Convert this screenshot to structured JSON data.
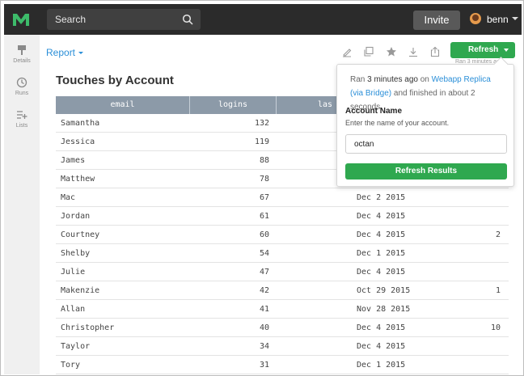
{
  "app": {
    "logo_icon": "mode-logo-icon",
    "search_label": "Search",
    "invite_label": "Invite",
    "user_name": "benn"
  },
  "sidebar": {
    "items": [
      {
        "label": "Details",
        "icon": "details-icon"
      },
      {
        "label": "Runs",
        "icon": "clock-icon"
      },
      {
        "label": "Lists",
        "icon": "list-add-icon"
      }
    ]
  },
  "report": {
    "dropdown_label": "Report",
    "title": "Touches by Account",
    "refresh_label": "Refresh",
    "ran_hint": "Ran 3 minutes ago",
    "toolbar_icons": [
      "edit-icon",
      "duplicate-icon",
      "star-icon",
      "download-icon",
      "share-icon"
    ]
  },
  "table": {
    "columns": [
      "email",
      "logins",
      "las"
    ],
    "rows": [
      {
        "name": "Samantha",
        "logins": "132",
        "date": "",
        "extra": ""
      },
      {
        "name": "Jessica",
        "logins": "119",
        "date": "",
        "extra": ""
      },
      {
        "name": "James",
        "logins": "88",
        "date": "",
        "extra": ""
      },
      {
        "name": "Matthew",
        "logins": "78",
        "date": "",
        "extra": ""
      },
      {
        "name": "Mac",
        "logins": "67",
        "date": "Dec 2 2015",
        "extra": ""
      },
      {
        "name": "Jordan",
        "logins": "61",
        "date": "Dec 4 2015",
        "extra": ""
      },
      {
        "name": "Courtney",
        "logins": "60",
        "date": "Dec 4 2015",
        "extra": "2"
      },
      {
        "name": "Shelby",
        "logins": "54",
        "date": "Dec 1 2015",
        "extra": ""
      },
      {
        "name": "Julie",
        "logins": "47",
        "date": "Dec 4 2015",
        "extra": ""
      },
      {
        "name": "Makenzie",
        "logins": "42",
        "date": "Oct 29 2015",
        "extra": "1"
      },
      {
        "name": "Allan",
        "logins": "41",
        "date": "Nov 28 2015",
        "extra": ""
      },
      {
        "name": "Christopher",
        "logins": "40",
        "date": "Dec 4 2015",
        "extra": "10"
      },
      {
        "name": "Taylor",
        "logins": "34",
        "date": "Dec 4 2015",
        "extra": ""
      },
      {
        "name": "Tory",
        "logins": "31",
        "date": "Dec 1 2015",
        "extra": ""
      }
    ]
  },
  "popover": {
    "status_prefix": "Ran",
    "status_time": "3 minutes ago",
    "status_on": "on",
    "status_source": "Webapp Replica (via Bridge)",
    "status_suffix": "and finished in about 2 seconds",
    "field_label": "Account Name",
    "field_help": "Enter the name of your account.",
    "field_value": "octan",
    "button_label": "Refresh Results"
  },
  "colors": {
    "topbar": "#2b2b2b",
    "accent_green": "#2fa84f",
    "link_blue": "#2b8fd8",
    "table_header": "#8c9aa8",
    "logo_green": "#3dbb6a"
  }
}
